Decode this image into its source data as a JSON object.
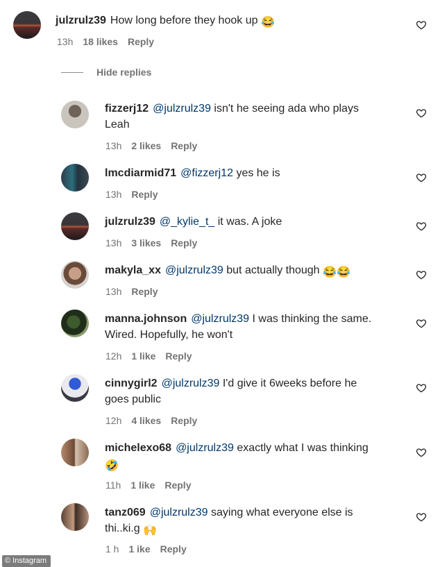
{
  "top_comment": {
    "username": "julzrulz39",
    "text": "How long before they hook up",
    "emoji": "😂",
    "time": "13h",
    "likes": "18 likes",
    "reply": "Reply"
  },
  "hide_replies": "Hide replies",
  "replies": [
    {
      "username": "fizzerj12",
      "mention": "@julzrulz39",
      "text_line1": "isn't he seeing ada who plays",
      "text_line2": "Leah",
      "time": "13h",
      "likes": "2 likes",
      "reply": "Reply"
    },
    {
      "username": "lmcdiarmid71",
      "mention": "@fizzerj12",
      "text_line1": "yes he is",
      "time": "13h",
      "reply": "Reply"
    },
    {
      "username": "julzrulz39",
      "mention": "@_kylie_t_",
      "text_line1": "it was. A joke",
      "time": "13h",
      "likes": "3 likes",
      "reply": "Reply"
    },
    {
      "username": "makyla_xx",
      "mention": "@julzrulz39",
      "text_line1": "but actually though",
      "emoji": "😂😂",
      "time": "13h",
      "reply": "Reply"
    },
    {
      "username": "manna.johnson",
      "mention": "@julzrulz39",
      "text_line1": "I was thinking the same.",
      "text_line2": "Wired. Hopefully, he won't",
      "time": "12h",
      "likes": "1 like",
      "reply": "Reply"
    },
    {
      "username": "cinnygirl2",
      "mention": "@julzrulz39",
      "text_line1": "I'd give it 6weeks before he",
      "text_line2": "goes public",
      "time": "12h",
      "likes": "4 likes",
      "reply": "Reply"
    },
    {
      "username": "michelexo68",
      "mention": "@julzrulz39",
      "text_line1": "exactly what I was thinking",
      "text_line2_emoji": "🤣",
      "time": "11h",
      "likes": "1 like",
      "reply": "Reply"
    },
    {
      "username": "tanz069",
      "mention": "@julzrulz39",
      "text_line1": "saying what everyone else is",
      "text_line2": "thi..ki.g",
      "text_line2_emoji": "🙌",
      "time": "1 h",
      "likes": "1 ike",
      "reply": "Reply"
    }
  ],
  "watermark": "© Instagram",
  "icons": {
    "like": "heart-outline-icon"
  },
  "colors": {
    "text": "#262626",
    "mention": "#00376b",
    "meta": "#737373"
  }
}
